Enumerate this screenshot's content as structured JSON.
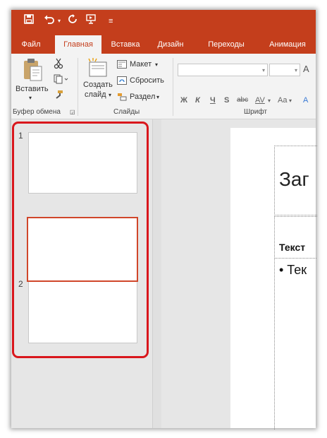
{
  "quick_access": {
    "save_icon": "save-icon",
    "undo_icon": "undo-icon",
    "redo_icon": "repeat-icon",
    "present_icon": "start-from-beginning-icon",
    "customize_icon": "customize-qat-icon"
  },
  "tabs": [
    "Файл",
    "Главная",
    "Вставка",
    "Дизайн",
    "Переходы",
    "Анимация"
  ],
  "active_tab": "Главная",
  "ribbon": {
    "clipboard": {
      "paste_label": "Вставить",
      "group_label": "Буфер обмена"
    },
    "slides": {
      "new_slide_label_1": "Создать",
      "new_slide_label_2": "слайд",
      "layout_label": "Макет",
      "reset_label": "Сбросить",
      "section_label": "Раздел",
      "group_label": "Слайды"
    },
    "font": {
      "group_label": "Шрифт",
      "grow_font": "A",
      "bold": "Ж",
      "italic": "К",
      "underline": "Ч",
      "shadow": "S",
      "strike": "abc",
      "spacing": "AV",
      "case": "Aa",
      "clear": "A"
    }
  },
  "thumbnails": [
    {
      "number": "1"
    },
    {
      "number": "2"
    }
  ],
  "slide": {
    "title_text": "Заг",
    "body_heading": "Текст",
    "bullet_text": "• Тек"
  },
  "colors": {
    "accent": "#c43e1c",
    "highlight": "#d9171d",
    "drop_indicator": "#d0462a"
  }
}
